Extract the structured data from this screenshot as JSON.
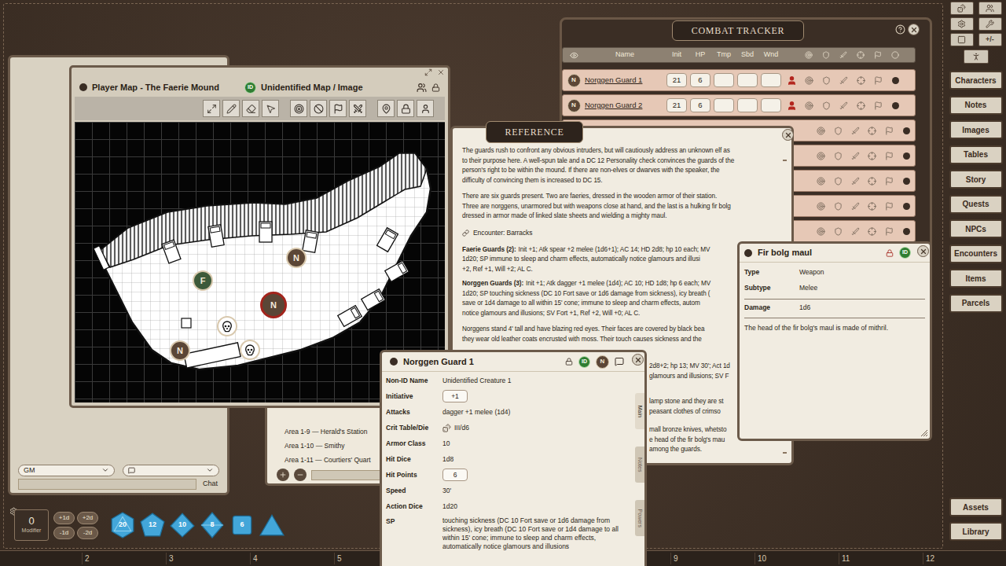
{
  "map_window": {
    "title": "Player Map - The Faerie Mound",
    "id_badge": "ID",
    "subtitle": "Unidentified Map / Image",
    "tokens": [
      {
        "kind": "letter",
        "label": "N",
        "color": "#5b4636",
        "selected": false
      },
      {
        "kind": "letter",
        "label": "F",
        "color": "#3d5a3a",
        "selected": false
      },
      {
        "kind": "letter",
        "label": "N",
        "color": "#5b4636",
        "selected": true
      },
      {
        "kind": "letter",
        "label": "N",
        "color": "#5b4636",
        "selected": false
      },
      {
        "kind": "monster",
        "selected": false
      },
      {
        "kind": "monster",
        "selected": false
      }
    ]
  },
  "combat_tracker": {
    "title": "COMBAT TRACKER",
    "columns": [
      "Name",
      "Init",
      "HP",
      "Tmp",
      "Sbd",
      "Wnd"
    ],
    "rows": [
      {
        "kind": "creature",
        "token": "N",
        "name": "Norggen Guard 1",
        "init": "21",
        "hp": "6",
        "tmp": "",
        "sbd": "",
        "wnd": ""
      },
      {
        "kind": "creature",
        "token": "N",
        "name": "Norggen Guard 2",
        "init": "21",
        "hp": "6",
        "tmp": "",
        "sbd": "",
        "wnd": ""
      },
      {
        "kind": "covered"
      },
      {
        "kind": "covered"
      },
      {
        "kind": "covered"
      },
      {
        "kind": "covered"
      },
      {
        "kind": "covered"
      }
    ]
  },
  "reference": {
    "title": "REFERENCE",
    "intro_paragraphs": [
      [
        "The guards rush to confront any obvious intruders, but will cautiously address an unknown elf as",
        "to their purpose here. A well-spun tale and a DC 12 Personality check convinces the guards of the",
        "person's right to be within the mound. If there are non-elves or dwarves with the speaker, the",
        "difficulty of convincing them is increased to DC 15."
      ],
      [
        "There are six guards present. Two are faeries, dressed in the wooden armor of their station.",
        "Three are norggens, unarmored but with weapons close at hand, and the last is a hulking fir bolg",
        "dressed in armor made of linked slate sheets and wielding a mighty maul."
      ]
    ],
    "encounter_link": "Encounter: Barracks",
    "stat_blocks": [
      {
        "label": "Faerie Guards (2):",
        "first_line": "Init +1; Atk spear +2 melee (1d6+1); AC 14; HD 2d8; hp 10 each; MV",
        "lines": [
          "1d20; SP immune to sleep and charm effects, automatically notice glamours and illusi",
          "+2, Ref +1, Will +2; AL C."
        ]
      },
      {
        "label": "Norggen Guards (3):",
        "first_line": "Init +1; Atk dagger +1 melee (1d4); AC 10; HD 1d8; hp 6 each; MV",
        "lines": [
          "1d20; SP touching sickness (DC 10 Fort save or 1d6 damage from sickness), icy breath (",
          "save or 1d4 damage to all within 15' cone; immune to sleep and charm effects, autom",
          "notice glamours and illusions; SV Fort +1, Ref +2, Will +0; AL C."
        ]
      }
    ],
    "narrative_lines": [
      "Norggens stand 4' tall and have blazing red eyes. Their faces are covered by black bea",
      "they wear old leather coats encrusted with moss. Their touch causes sickness and the"
    ],
    "fragment_groups": [
      [
        "2d8+2; hp 13; MV 30'; Act 1d",
        "glamours and illusions; SV F"
      ],
      [
        "lamp stone and they are st",
        "peasant clothes of crimso"
      ],
      [
        "mall bronze knives, whetsto",
        "e head of the fir bolg's mau",
        "among the guards."
      ]
    ]
  },
  "story_index": {
    "items": [
      "Area 1-9 — Herald's Station",
      "Area 1-10 — Smithy",
      "Area 1-11 — Courtiers' Quart"
    ]
  },
  "creature_window": {
    "title": "Norggen Guard 1",
    "id_badge": "ID",
    "token": "N",
    "fields": [
      {
        "label": "Non-ID Name",
        "value": "Unidentified Creature 1",
        "kind": "plain"
      },
      {
        "label": "Initiative",
        "value": "+1",
        "kind": "boxed"
      },
      {
        "label": "Attacks",
        "value": "dagger +1 melee (1d4)",
        "kind": "plain"
      },
      {
        "label": "Crit Table/Die",
        "value": "III/d6",
        "kind": "icon"
      },
      {
        "label": "Armor Class",
        "value": "10",
        "kind": "plain"
      },
      {
        "label": "Hit Dice",
        "value": "1d8",
        "kind": "plain"
      },
      {
        "label": "Hit Points",
        "value": "6",
        "kind": "boxed"
      },
      {
        "label": "Speed",
        "value": "30'",
        "kind": "plain"
      },
      {
        "label": "Action Dice",
        "value": "1d20",
        "kind": "plain"
      },
      {
        "label": "SP",
        "value": "touching sickness (DC 10 Fort save or 1d6 damage from sickness), icy breath (DC 10 Fort save or 1d4 damage to all within 15' cone; immune to sleep and charm effects, automatically notice glamours and illusions",
        "kind": "plain"
      }
    ],
    "tabs": [
      {
        "label": "Main",
        "selected": true
      },
      {
        "label": "Notes",
        "selected": false
      },
      {
        "label": "Powers",
        "selected": false
      }
    ]
  },
  "item_window": {
    "title": "Fir bolg maul",
    "id_badge": "ID",
    "fields": [
      {
        "label": "Type",
        "value": "Weapon"
      },
      {
        "label": "Subtype",
        "value": "Melee"
      },
      {
        "label": "Damage",
        "value": "1d6"
      }
    ],
    "description": "The head of the fir bolg's maul is made of mithril."
  },
  "chat": {
    "identity": "GM",
    "button": "Chat"
  },
  "dice_tray": {
    "modifier": "0",
    "modifier_label": "Modifier",
    "buttons": [
      "+1d",
      "+2d",
      "-1d",
      "-2d"
    ],
    "dice": [
      {
        "kind": "d20",
        "label": "20"
      },
      {
        "kind": "d12",
        "label": "12"
      },
      {
        "kind": "d10",
        "label": "10"
      },
      {
        "kind": "d8",
        "label": "8"
      },
      {
        "kind": "d6",
        "label": "6"
      },
      {
        "kind": "d4"
      }
    ]
  },
  "sidebar": {
    "zoom_key": "+/-",
    "buttons": [
      "Characters",
      "Notes",
      "Images",
      "Tables",
      "Story",
      "Quests",
      "NPCs",
      "Encounters",
      "Items",
      "Parcels"
    ],
    "bottom_buttons": [
      "Assets",
      "Library"
    ]
  },
  "hotbar": {
    "left_slots": [
      "2",
      "3",
      "4",
      "5"
    ],
    "right_slots": [
      "9",
      "10",
      "11",
      "12"
    ]
  }
}
